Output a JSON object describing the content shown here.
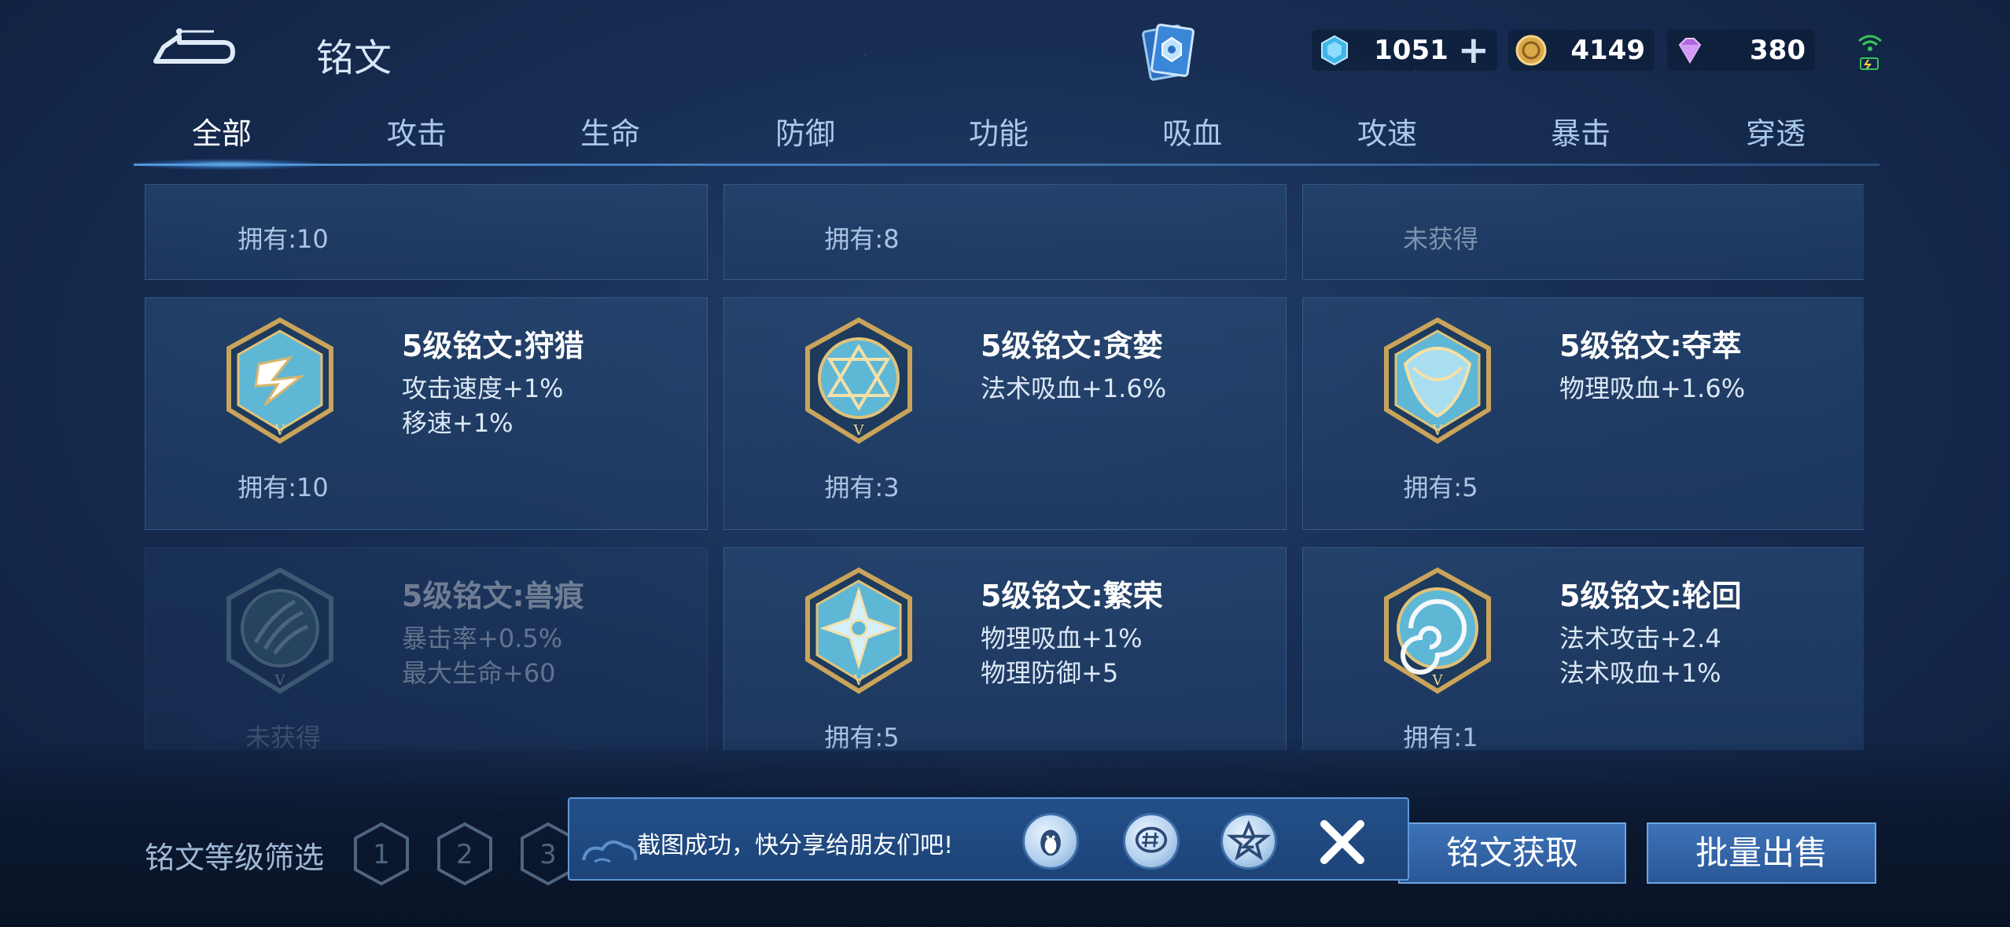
{
  "header": {
    "title": "铭文",
    "currencies": [
      {
        "name": "diamond-coupon",
        "value": "1051"
      },
      {
        "name": "gold-coin",
        "value": "4149"
      },
      {
        "name": "gem",
        "value": "380"
      }
    ]
  },
  "tabs": [
    "全部",
    "攻击",
    "生命",
    "防御",
    "功能",
    "吸血",
    "攻速",
    "暴击",
    "穿透"
  ],
  "cards": [
    {
      "owned": "拥有:10"
    },
    {
      "owned": "拥有:8"
    },
    {
      "owned": "未获得"
    },
    {
      "title": "5级铭文:狩猎",
      "stats": [
        "攻击速度+1%",
        "移速+1%"
      ],
      "owned": "拥有:10",
      "icon": "lightning-emblem-icon"
    },
    {
      "title": "5级铭文:贪婪",
      "stats": [
        "法术吸血+1.6%",
        ""
      ],
      "owned": "拥有:3",
      "icon": "triangle-circle-emblem-icon"
    },
    {
      "title": "5级铭文:夺萃",
      "stats": [
        "物理吸血+1.6%",
        ""
      ],
      "owned": "拥有:5",
      "icon": "knot-emblem-icon"
    },
    {
      "title": "5级铭文:兽痕",
      "stats": [
        "暴击率+0.5%",
        "最大生命+60"
      ],
      "owned": "未获得",
      "icon": "claw-emblem-icon"
    },
    {
      "title": "5级铭文:繁荣",
      "stats": [
        "物理吸血+1%",
        "物理防御+5"
      ],
      "owned": "拥有:5",
      "icon": "crown-emblem-icon"
    },
    {
      "title": "5级铭文:轮回",
      "stats": [
        "法术攻击+2.4",
        "法术吸血+1%"
      ],
      "owned": "拥有:1",
      "icon": "swirl-emblem-icon"
    }
  ],
  "bottom": {
    "filter_label": "铭文等级筛选",
    "levels": [
      "1",
      "2",
      "3"
    ],
    "acquire_label": "铭文获取",
    "sell_label": "批量出售"
  },
  "toast": {
    "message": "截图成功，快分享给朋友们吧!"
  },
  "colors": {
    "background": "#172d52",
    "accent": "#6fa4e0",
    "gold": "#c9a45a"
  }
}
